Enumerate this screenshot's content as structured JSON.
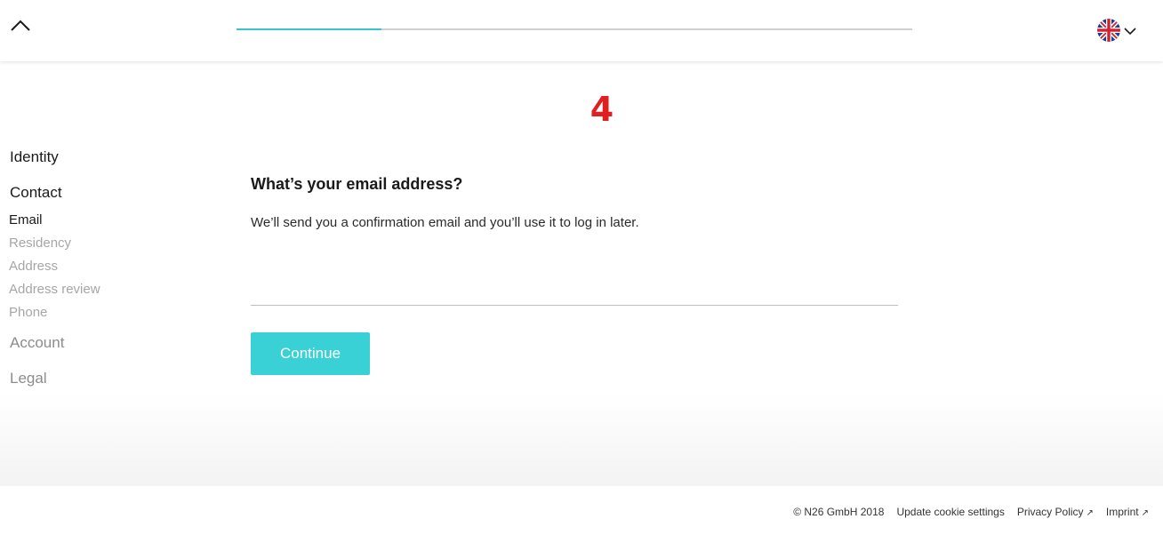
{
  "header": {
    "collapse_icon": "chevron-up-icon",
    "progress_fraction": 0.215,
    "progress_color": "#36c5cf",
    "language_flag_icon": "uk-flag-icon",
    "language_dropdown_icon": "chevron-down-icon"
  },
  "annotation": {
    "step_number": "4",
    "color": "#e02020"
  },
  "sidebar": {
    "sections": [
      {
        "label": "Identity",
        "state": "active"
      },
      {
        "label": "Contact",
        "state": "active"
      },
      {
        "label": "Account",
        "state": "inactive"
      },
      {
        "label": "Legal",
        "state": "inactive"
      }
    ],
    "contact_steps": [
      {
        "label": "Email",
        "state": "current"
      },
      {
        "label": "Residency",
        "state": "upcoming"
      },
      {
        "label": "Address",
        "state": "upcoming"
      },
      {
        "label": "Address review",
        "state": "upcoming"
      },
      {
        "label": "Phone",
        "state": "upcoming"
      }
    ]
  },
  "form": {
    "question": "What’s your email address?",
    "hint": "We’ll send you a confirmation email and you’ll use it to log in later.",
    "email_value": "",
    "email_placeholder": "",
    "continue_label": "Continue",
    "accent_color": "#3ad1d6"
  },
  "footer": {
    "copyright": "© N26 GmbH 2018",
    "cookie_link": "Update cookie settings",
    "privacy_link": "Privacy Policy",
    "imprint_link": "Imprint",
    "external_icon": "external-link-icon"
  }
}
